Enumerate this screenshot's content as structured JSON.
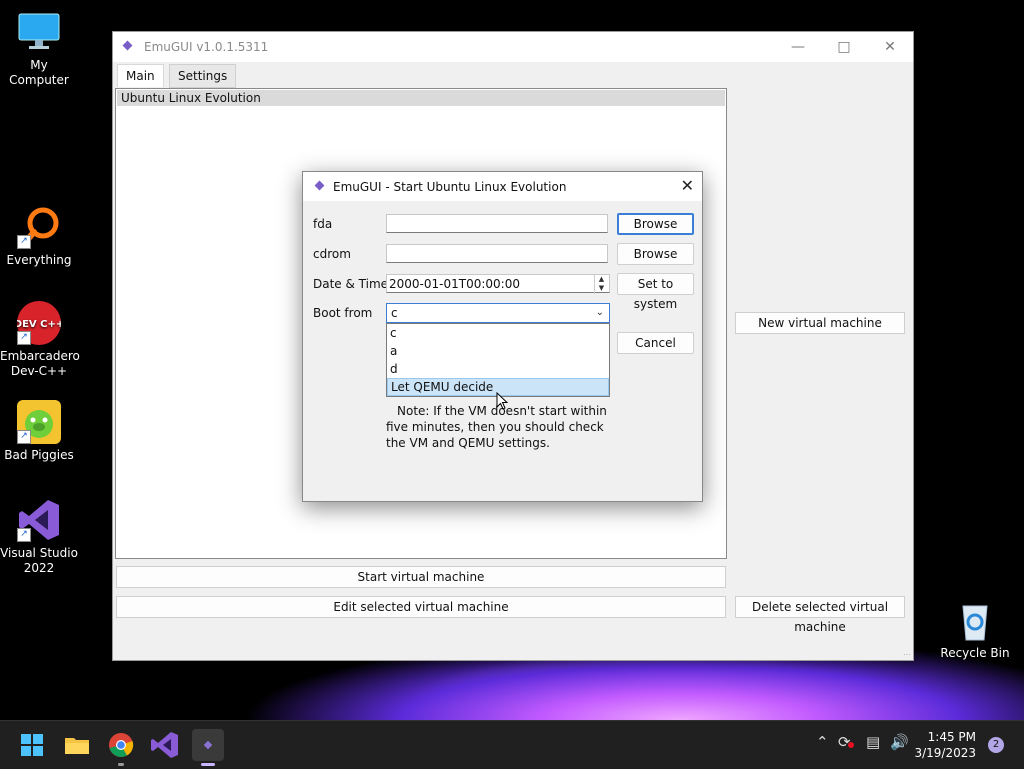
{
  "desktop": {
    "icons": [
      {
        "label": "My Computer"
      },
      {
        "label": "Everything"
      },
      {
        "label": "Embarcadero Dev-C++"
      },
      {
        "label": "Bad Piggies"
      },
      {
        "label": "Visual Studio 2022"
      },
      {
        "label": "Recycle Bin"
      }
    ],
    "devcpp_logo_text": "DEV C++"
  },
  "main_window": {
    "title": "EmuGUI v1.0.1.5311",
    "tabs": [
      {
        "label": "Main"
      },
      {
        "label": "Settings"
      }
    ],
    "vm_list": [
      "Ubuntu Linux Evolution"
    ],
    "buttons": {
      "new_vm": "New virtual machine",
      "start_vm": "Start virtual machine",
      "edit_vm": "Edit selected virtual machine",
      "delete_vm": "Delete selected virtual machine"
    }
  },
  "dialog": {
    "title": "EmuGUI - Start Ubuntu Linux Evolution",
    "fda": {
      "label": "fda",
      "value": "",
      "button": "Browse"
    },
    "cdrom": {
      "label": "cdrom",
      "value": "",
      "button": "Browse"
    },
    "datetime": {
      "label": "Date & Time",
      "value": "2000-01-01T00:00:00",
      "button": "Set to system"
    },
    "boot": {
      "label": "Boot from",
      "selected": "c",
      "options": [
        "c",
        "a",
        "d",
        "Let QEMU decide"
      ],
      "highlighted_index": 3
    },
    "cancel_button": "Cancel",
    "note": "Note: If the VM doesn't start within five minutes, then you should check the VM and QEMU settings."
  },
  "taskbar": {
    "time": "1:45 PM",
    "date": "3/19/2023",
    "notification_count": "2"
  },
  "colors": {
    "accent": "#3a7ed6",
    "highlight": "#cce4f7",
    "taskbar": "#202020"
  }
}
